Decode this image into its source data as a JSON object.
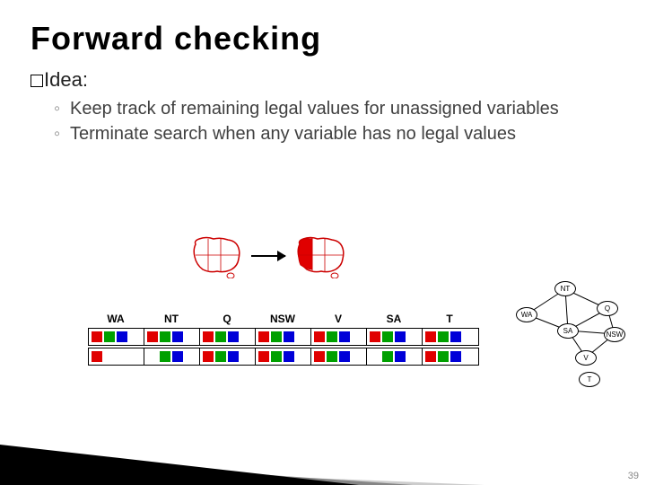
{
  "title": "Forward checking",
  "idea_label": "Idea:",
  "bullets": [
    "Keep track of remaining legal values for unassigned variables",
    "Terminate search when any variable has no legal values"
  ],
  "chart_data": {
    "type": "table",
    "columns": [
      "WA",
      "NT",
      "Q",
      "NSW",
      "V",
      "SA",
      "T"
    ],
    "rows": [
      {
        "WA": [
          "r",
          "g",
          "b"
        ],
        "NT": [
          "r",
          "g",
          "b"
        ],
        "Q": [
          "r",
          "g",
          "b"
        ],
        "NSW": [
          "r",
          "g",
          "b"
        ],
        "V": [
          "r",
          "g",
          "b"
        ],
        "SA": [
          "r",
          "g",
          "b"
        ],
        "T": [
          "r",
          "g",
          "b"
        ]
      },
      {
        "WA": [
          "r"
        ],
        "NT": [
          "g",
          "b"
        ],
        "Q": [
          "r",
          "g",
          "b"
        ],
        "NSW": [
          "r",
          "g",
          "b"
        ],
        "V": [
          "r",
          "g",
          "b"
        ],
        "SA": [
          "g",
          "b"
        ],
        "T": [
          "r",
          "g",
          "b"
        ]
      }
    ],
    "color_map": {
      "r": "red",
      "g": "green",
      "b": "blue"
    },
    "graph_nodes": [
      "NT",
      "WA",
      "Q",
      "SA",
      "NSW",
      "V",
      "T"
    ],
    "graph_edges": [
      [
        "WA",
        "NT"
      ],
      [
        "WA",
        "SA"
      ],
      [
        "NT",
        "SA"
      ],
      [
        "NT",
        "Q"
      ],
      [
        "SA",
        "Q"
      ],
      [
        "SA",
        "NSW"
      ],
      [
        "SA",
        "V"
      ],
      [
        "Q",
        "NSW"
      ],
      [
        "NSW",
        "V"
      ]
    ]
  },
  "page_number": "39"
}
